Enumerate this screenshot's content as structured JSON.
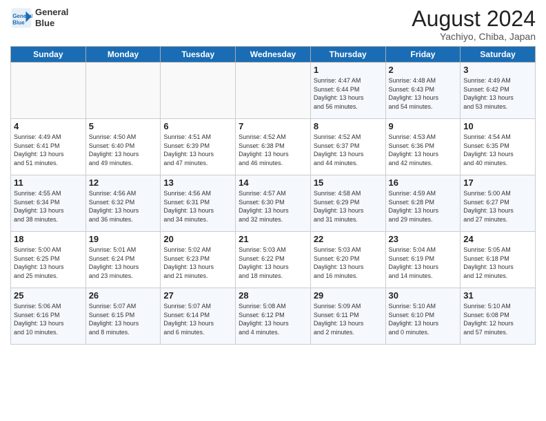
{
  "logo": {
    "line1": "General",
    "line2": "Blue"
  },
  "title": "August 2024",
  "subtitle": "Yachiyo, Chiba, Japan",
  "weekdays": [
    "Sunday",
    "Monday",
    "Tuesday",
    "Wednesday",
    "Thursday",
    "Friday",
    "Saturday"
  ],
  "weeks": [
    [
      {
        "day": "",
        "info": ""
      },
      {
        "day": "",
        "info": ""
      },
      {
        "day": "",
        "info": ""
      },
      {
        "day": "",
        "info": ""
      },
      {
        "day": "1",
        "info": "Sunrise: 4:47 AM\nSunset: 6:44 PM\nDaylight: 13 hours\nand 56 minutes."
      },
      {
        "day": "2",
        "info": "Sunrise: 4:48 AM\nSunset: 6:43 PM\nDaylight: 13 hours\nand 54 minutes."
      },
      {
        "day": "3",
        "info": "Sunrise: 4:49 AM\nSunset: 6:42 PM\nDaylight: 13 hours\nand 53 minutes."
      }
    ],
    [
      {
        "day": "4",
        "info": "Sunrise: 4:49 AM\nSunset: 6:41 PM\nDaylight: 13 hours\nand 51 minutes."
      },
      {
        "day": "5",
        "info": "Sunrise: 4:50 AM\nSunset: 6:40 PM\nDaylight: 13 hours\nand 49 minutes."
      },
      {
        "day": "6",
        "info": "Sunrise: 4:51 AM\nSunset: 6:39 PM\nDaylight: 13 hours\nand 47 minutes."
      },
      {
        "day": "7",
        "info": "Sunrise: 4:52 AM\nSunset: 6:38 PM\nDaylight: 13 hours\nand 46 minutes."
      },
      {
        "day": "8",
        "info": "Sunrise: 4:52 AM\nSunset: 6:37 PM\nDaylight: 13 hours\nand 44 minutes."
      },
      {
        "day": "9",
        "info": "Sunrise: 4:53 AM\nSunset: 6:36 PM\nDaylight: 13 hours\nand 42 minutes."
      },
      {
        "day": "10",
        "info": "Sunrise: 4:54 AM\nSunset: 6:35 PM\nDaylight: 13 hours\nand 40 minutes."
      }
    ],
    [
      {
        "day": "11",
        "info": "Sunrise: 4:55 AM\nSunset: 6:34 PM\nDaylight: 13 hours\nand 38 minutes."
      },
      {
        "day": "12",
        "info": "Sunrise: 4:56 AM\nSunset: 6:32 PM\nDaylight: 13 hours\nand 36 minutes."
      },
      {
        "day": "13",
        "info": "Sunrise: 4:56 AM\nSunset: 6:31 PM\nDaylight: 13 hours\nand 34 minutes."
      },
      {
        "day": "14",
        "info": "Sunrise: 4:57 AM\nSunset: 6:30 PM\nDaylight: 13 hours\nand 32 minutes."
      },
      {
        "day": "15",
        "info": "Sunrise: 4:58 AM\nSunset: 6:29 PM\nDaylight: 13 hours\nand 31 minutes."
      },
      {
        "day": "16",
        "info": "Sunrise: 4:59 AM\nSunset: 6:28 PM\nDaylight: 13 hours\nand 29 minutes."
      },
      {
        "day": "17",
        "info": "Sunrise: 5:00 AM\nSunset: 6:27 PM\nDaylight: 13 hours\nand 27 minutes."
      }
    ],
    [
      {
        "day": "18",
        "info": "Sunrise: 5:00 AM\nSunset: 6:25 PM\nDaylight: 13 hours\nand 25 minutes."
      },
      {
        "day": "19",
        "info": "Sunrise: 5:01 AM\nSunset: 6:24 PM\nDaylight: 13 hours\nand 23 minutes."
      },
      {
        "day": "20",
        "info": "Sunrise: 5:02 AM\nSunset: 6:23 PM\nDaylight: 13 hours\nand 21 minutes."
      },
      {
        "day": "21",
        "info": "Sunrise: 5:03 AM\nSunset: 6:22 PM\nDaylight: 13 hours\nand 18 minutes."
      },
      {
        "day": "22",
        "info": "Sunrise: 5:03 AM\nSunset: 6:20 PM\nDaylight: 13 hours\nand 16 minutes."
      },
      {
        "day": "23",
        "info": "Sunrise: 5:04 AM\nSunset: 6:19 PM\nDaylight: 13 hours\nand 14 minutes."
      },
      {
        "day": "24",
        "info": "Sunrise: 5:05 AM\nSunset: 6:18 PM\nDaylight: 13 hours\nand 12 minutes."
      }
    ],
    [
      {
        "day": "25",
        "info": "Sunrise: 5:06 AM\nSunset: 6:16 PM\nDaylight: 13 hours\nand 10 minutes."
      },
      {
        "day": "26",
        "info": "Sunrise: 5:07 AM\nSunset: 6:15 PM\nDaylight: 13 hours\nand 8 minutes."
      },
      {
        "day": "27",
        "info": "Sunrise: 5:07 AM\nSunset: 6:14 PM\nDaylight: 13 hours\nand 6 minutes."
      },
      {
        "day": "28",
        "info": "Sunrise: 5:08 AM\nSunset: 6:12 PM\nDaylight: 13 hours\nand 4 minutes."
      },
      {
        "day": "29",
        "info": "Sunrise: 5:09 AM\nSunset: 6:11 PM\nDaylight: 13 hours\nand 2 minutes."
      },
      {
        "day": "30",
        "info": "Sunrise: 5:10 AM\nSunset: 6:10 PM\nDaylight: 13 hours\nand 0 minutes."
      },
      {
        "day": "31",
        "info": "Sunrise: 5:10 AM\nSunset: 6:08 PM\nDaylight: 12 hours\nand 57 minutes."
      }
    ]
  ]
}
